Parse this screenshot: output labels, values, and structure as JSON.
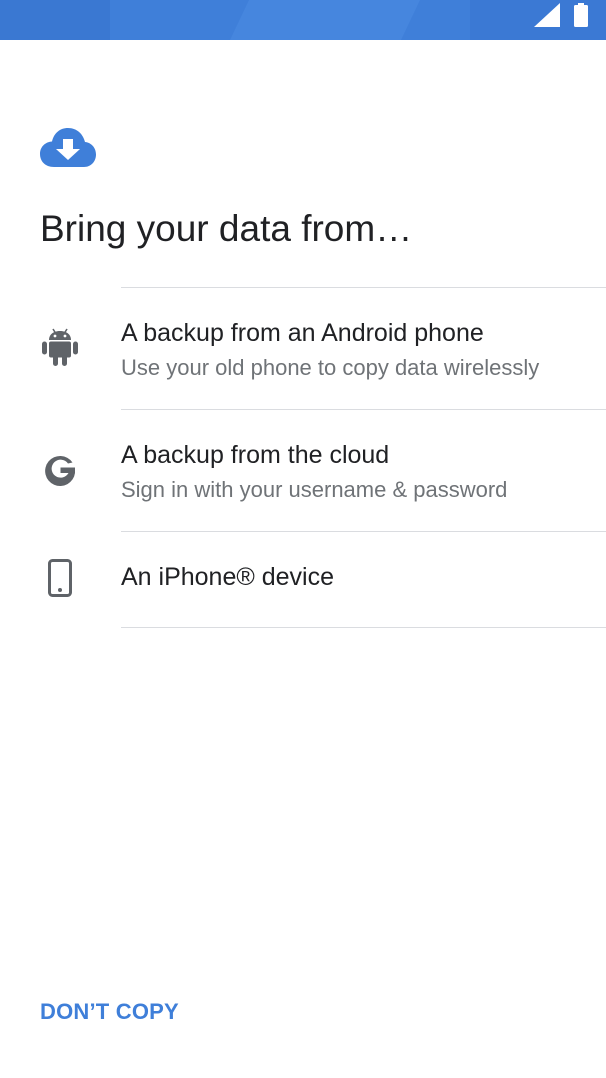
{
  "status_bar": {
    "color": "#3f7fd9",
    "icons": [
      "signal-icon",
      "battery-icon"
    ]
  },
  "hero": {
    "icon": "cloud-download-icon",
    "color": "#3f7fd9"
  },
  "title": "Bring your data from…",
  "options": [
    {
      "icon": "android-icon",
      "title": "A backup from an Android phone",
      "subtitle": "Use your old phone to copy data wirelessly"
    },
    {
      "icon": "google-icon",
      "title": "A backup from the cloud",
      "subtitle": "Sign in with your username & password"
    },
    {
      "icon": "phone-icon",
      "title": "An iPhone® device",
      "subtitle": ""
    }
  ],
  "footer": {
    "dont_copy_label": "DON’T COPY"
  },
  "colors": {
    "accent": "#3f7fd9",
    "text_primary": "#202124",
    "text_secondary": "#6f7377",
    "icon_gray": "#5f6368",
    "divider": "#dadce0"
  }
}
